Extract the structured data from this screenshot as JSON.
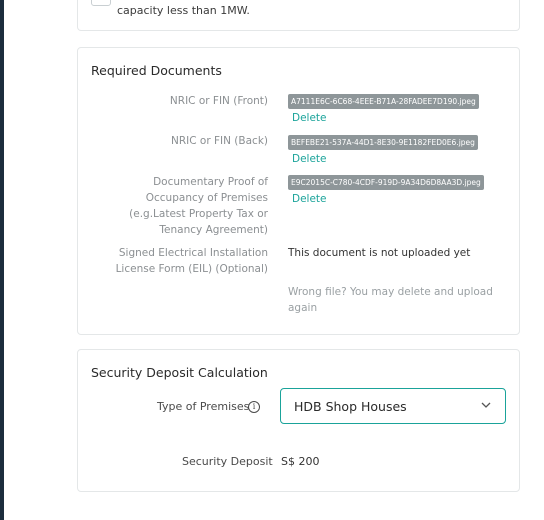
{
  "top_card": {
    "text": "capacity less than 1MW."
  },
  "required_documents": {
    "title": "Required Documents",
    "items": [
      {
        "label": "NRIC or FIN (Front)",
        "file": "A7111E6C-6C68-4EEE-B71A-28FADEE7D190.jpeg",
        "delete_label": "Delete"
      },
      {
        "label": "NRIC or FIN (Back)",
        "file": "BEFEBE21-537A-44D1-8E30-9E1182FED0E6.jpeg",
        "delete_label": "Delete"
      },
      {
        "label": "Documentary Proof of Occupancy of Premises (e.g.Latest Property Tax or Tenancy Agreement)",
        "file": "E9C2015C-C780-4CDF-919D-9A34D6D8AA3D.jpeg",
        "delete_label": "Delete"
      },
      {
        "label": "Signed Electrical Installation License Form (EIL) (Optional)",
        "status": "This document is not uploaded yet"
      }
    ],
    "hint": "Wrong file? You may delete and upload again"
  },
  "security_deposit": {
    "title": "Security Deposit Calculation",
    "premises_label": "Type of Premises",
    "premises_value": "HDB Shop Houses",
    "deposit_label": "Security Deposit",
    "deposit_value": "S$ 200"
  },
  "icons": {
    "info": "info-circle-icon",
    "dropdown": "chevron-down-icon"
  },
  "colors": {
    "accent": "#1aa39a",
    "chip": "#8e9699"
  }
}
